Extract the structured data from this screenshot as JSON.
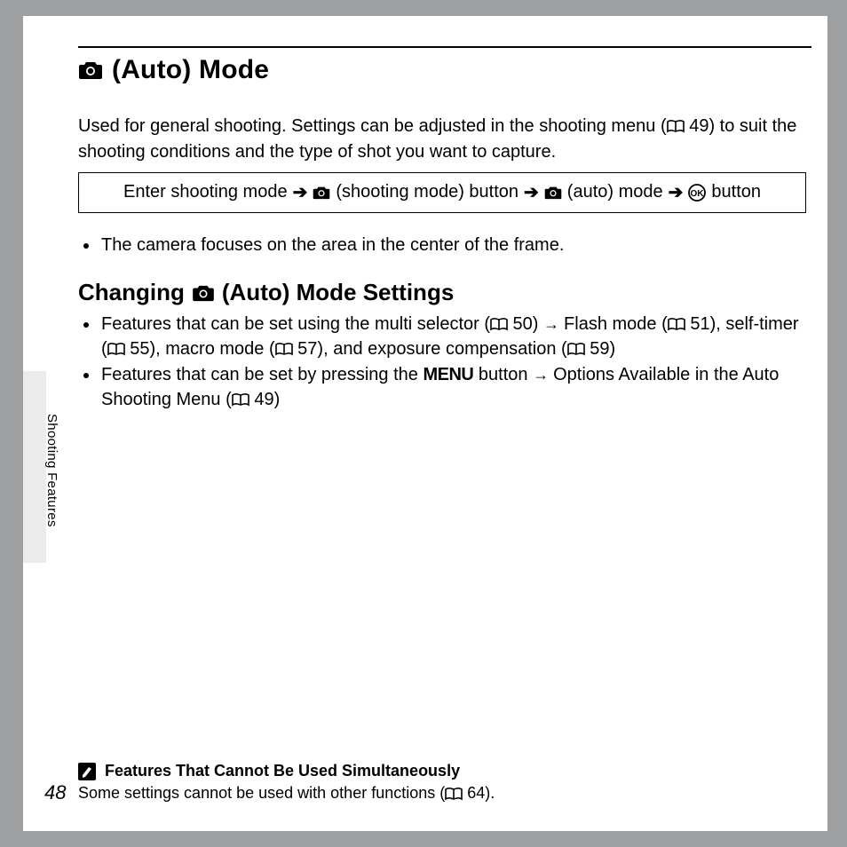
{
  "h1": "(Auto) Mode",
  "intro_a": "Used for general shooting. Settings can be adjusted in the shooting menu (",
  "intro_b": " 49) to suit the shooting conditions and the type of shot you want to capture.",
  "nav": {
    "a": "Enter shooting mode",
    "b": "(shooting mode) button",
    "c": "(auto) mode",
    "d": "button"
  },
  "bullet1": "The camera focuses on the area in the center of the frame.",
  "h2_a": "Changing",
  "h2_b": "(Auto) Mode Settings",
  "b2a_1": "Features that can be set using the multi selector (",
  "b2a_2": " 50)",
  "b2a_3": "Flash mode (",
  "b2a_4": " 51), self-timer (",
  "b2a_5": " 55), macro mode (",
  "b2a_6": " 57), and exposure compensation (",
  "b2a_7": " 59)",
  "b2b_1": "Features that can be set by pressing the ",
  "b2b_menu": "MENU",
  "b2b_2": " button",
  "b2b_3": "Options Available in the Auto Shooting Menu (",
  "b2b_4": " 49)",
  "side": "Shooting Features",
  "note_title": "Features That Cannot Be Used Simultaneously",
  "note_a": "Some settings cannot be used with other functions (",
  "note_b": " 64).",
  "page": "48"
}
